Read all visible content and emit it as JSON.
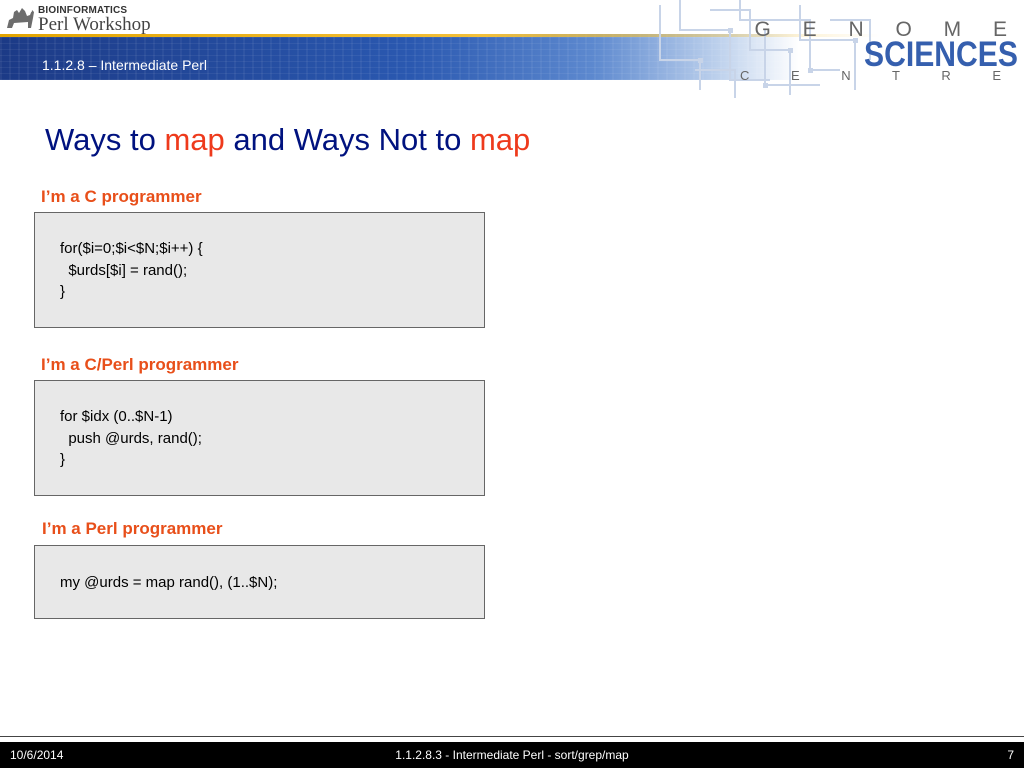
{
  "header": {
    "logo_line1": "BIOINFORMATICS",
    "logo_line2": "Perl Workshop",
    "section_label": "1.1.2.8 – Intermediate Perl",
    "org_line1": "G E N O M E",
    "org_line2": "SCIENCES",
    "org_line3": "C E N T R E"
  },
  "slide": {
    "title_part1": "Ways to ",
    "title_map1": "map",
    "title_part2": " and Ways Not to ",
    "title_map2": "map",
    "sections": [
      {
        "heading": "I’m a C programmer",
        "code": [
          "for($i=0;$i<$N;$i++) {",
          "  $urds[$i] = rand();",
          "}"
        ]
      },
      {
        "heading": "I’m a C/Perl programmer",
        "code": [
          "for $idx (0..$N-1)",
          "  push @urds, rand();",
          "}"
        ]
      },
      {
        "heading": "I’m a Perl programmer",
        "code": [
          "my @urds = map rand(), (1..$N);"
        ]
      }
    ]
  },
  "footer": {
    "date": "10/6/2014",
    "center": "1.1.2.8.3 - Intermediate Perl - sort/grep/map",
    "page_number": "7"
  },
  "colors": {
    "title_blue": "#00127f",
    "accent_red": "#ee3a1c",
    "heading_orange": "#e84f1a",
    "code_bg": "#e8e8e8",
    "banner_blue": "#2a58b0"
  }
}
